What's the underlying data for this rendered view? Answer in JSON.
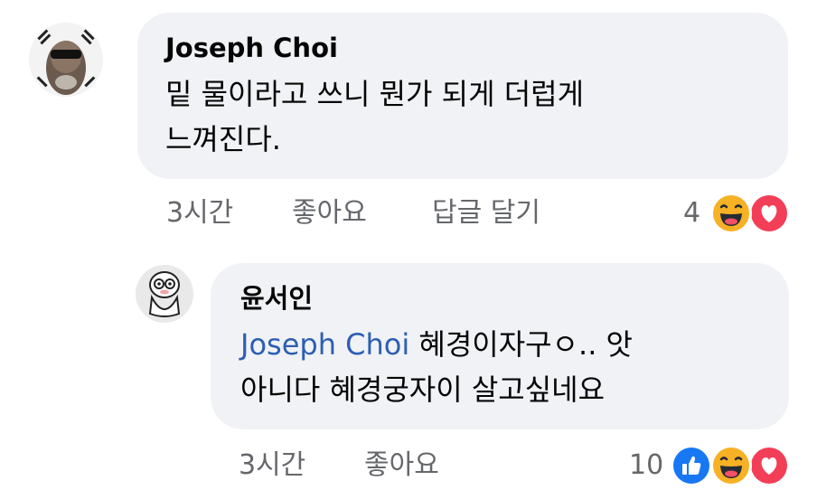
{
  "comments": [
    {
      "author": "Joseph Choi",
      "text_lines": [
        "밑 물이라고 쓰니 뭔가 되게 더럽게",
        "느껴진다."
      ],
      "actions": {
        "time": "3시간",
        "like": "좋아요",
        "reply": "답글 달기"
      },
      "reaction_count": "4",
      "reactions": [
        "haha-icon",
        "love-icon"
      ]
    },
    {
      "author": "윤서인",
      "mention": "Joseph Choi",
      "text_line1_rest": " 혜경이자구ㅇ.. 앗",
      "text_line2": "아니다 혜경궁자이 살고싶네요",
      "actions": {
        "time": "3시간",
        "like": "좋아요"
      },
      "reaction_count": "10",
      "reactions": [
        "like-icon",
        "haha-icon",
        "love-icon"
      ]
    }
  ],
  "colors": {
    "bubble": "#f0f2f5",
    "mention": "#2d5fb3",
    "meta": "#65676b",
    "like": "#1877f2",
    "love": "#f33e58",
    "haha": "#f7b125"
  }
}
